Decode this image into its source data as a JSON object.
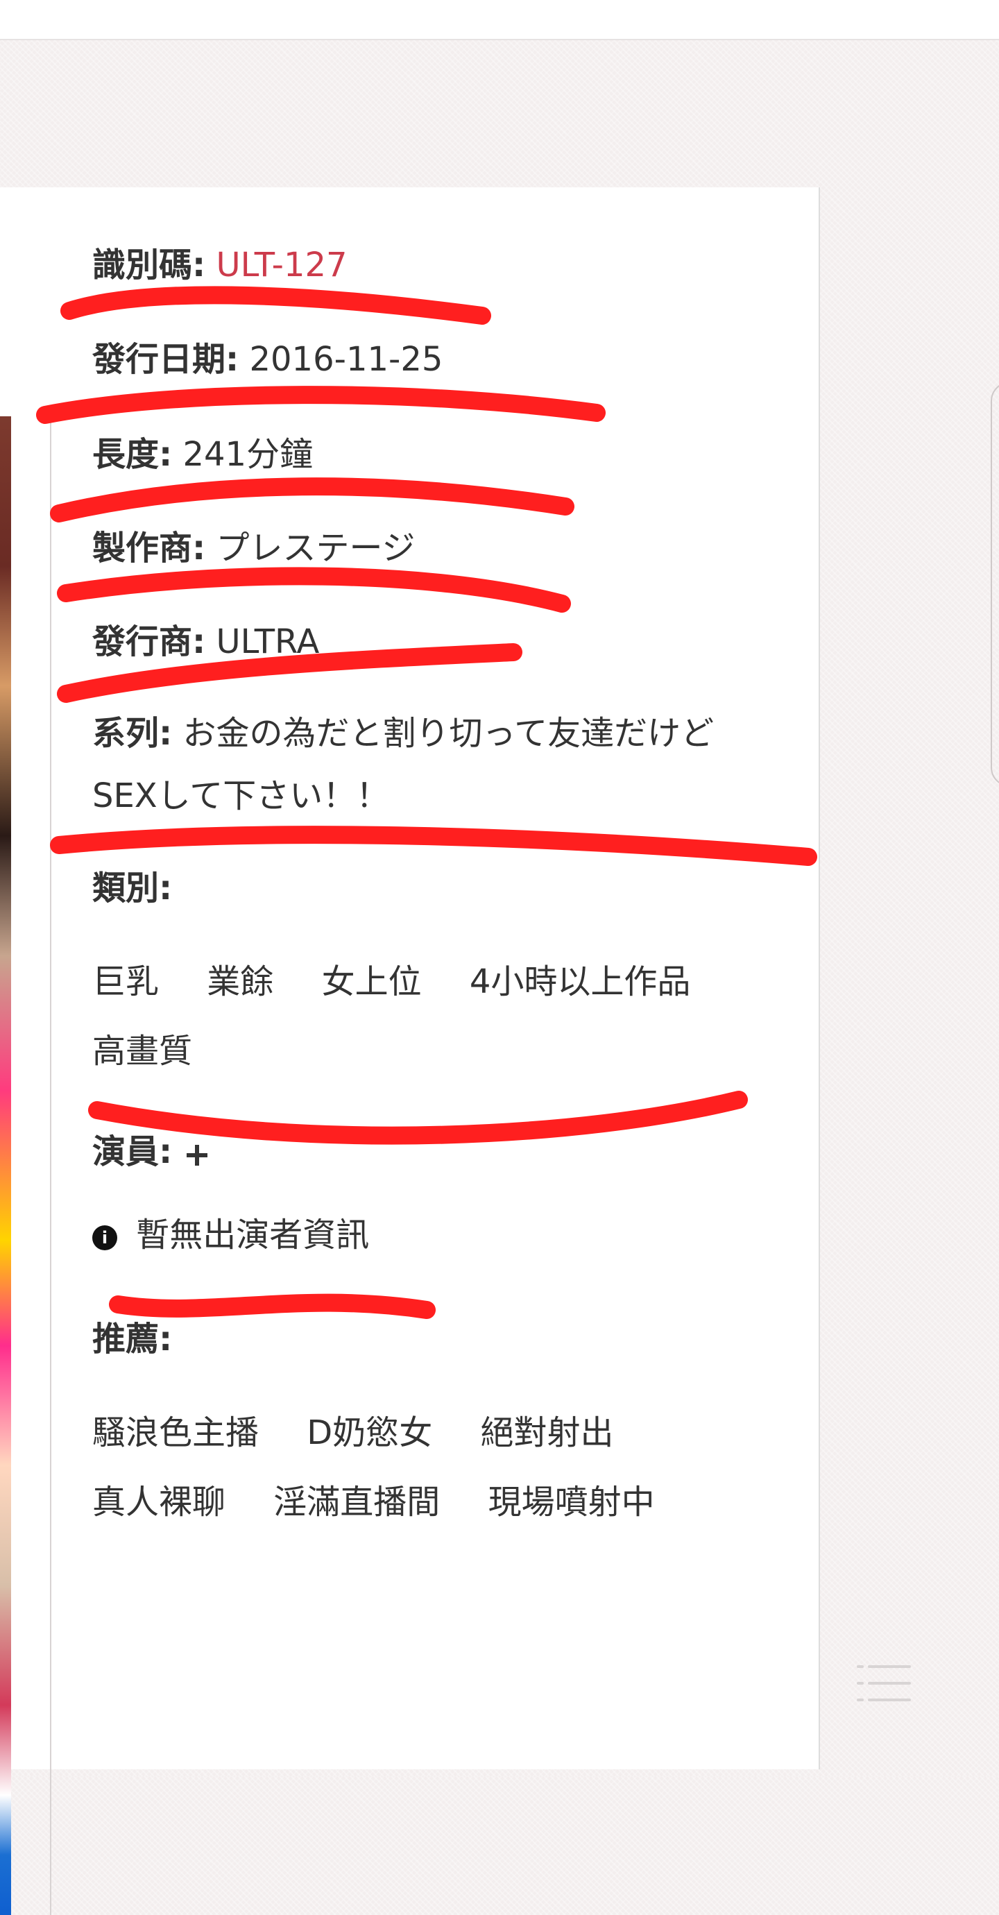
{
  "details": {
    "id_label": "識別碼:",
    "id_value": "ULT-127",
    "release_label": "發行日期:",
    "release_value": "2016-11-25",
    "length_label": "長度:",
    "length_value": "241分鐘",
    "maker_label": "製作商:",
    "maker_value": "プレステージ",
    "publisher_label": "發行商:",
    "publisher_value": "ULTRA",
    "series_label": "系列:",
    "series_value": "お金の為だと割り切って友達だけどSEXして下さい！！"
  },
  "genres": {
    "label": "類別:",
    "items": [
      "巨乳",
      "業餘",
      "女上位",
      "4小時以上作品",
      "高畫質"
    ]
  },
  "actors": {
    "label": "演員:",
    "none_text": "暫無出演者資訊"
  },
  "recommend": {
    "label": "推薦:",
    "items": [
      "騷浪色主播",
      "D奶慾女",
      "絕對射出",
      "真人裸聊",
      "淫滿直播間",
      "現場噴射中"
    ]
  },
  "colors": {
    "highlight_red": "#cc3b4b",
    "scribble_red": "#ff1f1f",
    "text_dark": "#333333"
  },
  "icons": {
    "add_actor": "plus-icon",
    "info": "info-circle-icon",
    "menu": "list-menu-icon"
  }
}
